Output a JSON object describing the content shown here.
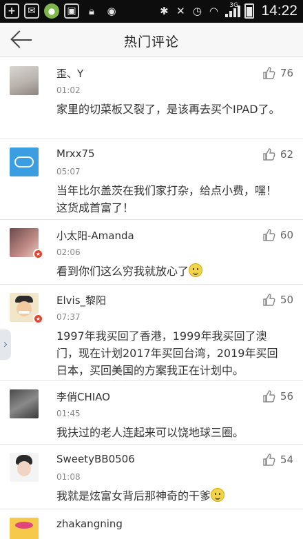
{
  "status_bar": {
    "time": "14:22",
    "network": "3G"
  },
  "header": {
    "title": "热门评论"
  },
  "comments": [
    {
      "user": "歪、Y",
      "time": "01:02",
      "likes": "76",
      "text": "家里的切菜板又裂了，是该再去买个IPAD了。",
      "emoji": false,
      "badge": false
    },
    {
      "user": "Mrxx75",
      "time": "05:07",
      "likes": "62",
      "text": "当年比尔盖茨在我们家打杂，给点小费，嘿！这货成首富了！",
      "emoji": false,
      "badge": false
    },
    {
      "user": "小太阳-Amanda",
      "time": "02:06",
      "likes": "60",
      "text": "看到你们这么穷我就放心了",
      "emoji": true,
      "badge": true
    },
    {
      "user": "Elvis_黎阳",
      "time": "07:37",
      "likes": "50",
      "text": "1997年我买回了香港，1999年我买回了澳门，现在计划2017年买回台湾，2019年买回日本，买回美国的方案我正在计划中。",
      "emoji": false,
      "badge": true
    },
    {
      "user": "李俏CHIAO",
      "time": "01:45",
      "likes": "56",
      "text": "我扶过的老人连起来可以饶地球三圈。",
      "emoji": false,
      "badge": false
    },
    {
      "user": "SweetyBB0506",
      "time": "01:08",
      "likes": "54",
      "text": "我就是炫富女背后那神奇的干爹",
      "emoji": true,
      "badge": false
    },
    {
      "user": "zhakangning",
      "time": "",
      "likes": "",
      "text": "",
      "emoji": false,
      "badge": false
    }
  ],
  "colors": {
    "accent_badge": "#e0452b",
    "header_bg": "#f7f7f7",
    "status_bg": "#0d0d0d"
  }
}
